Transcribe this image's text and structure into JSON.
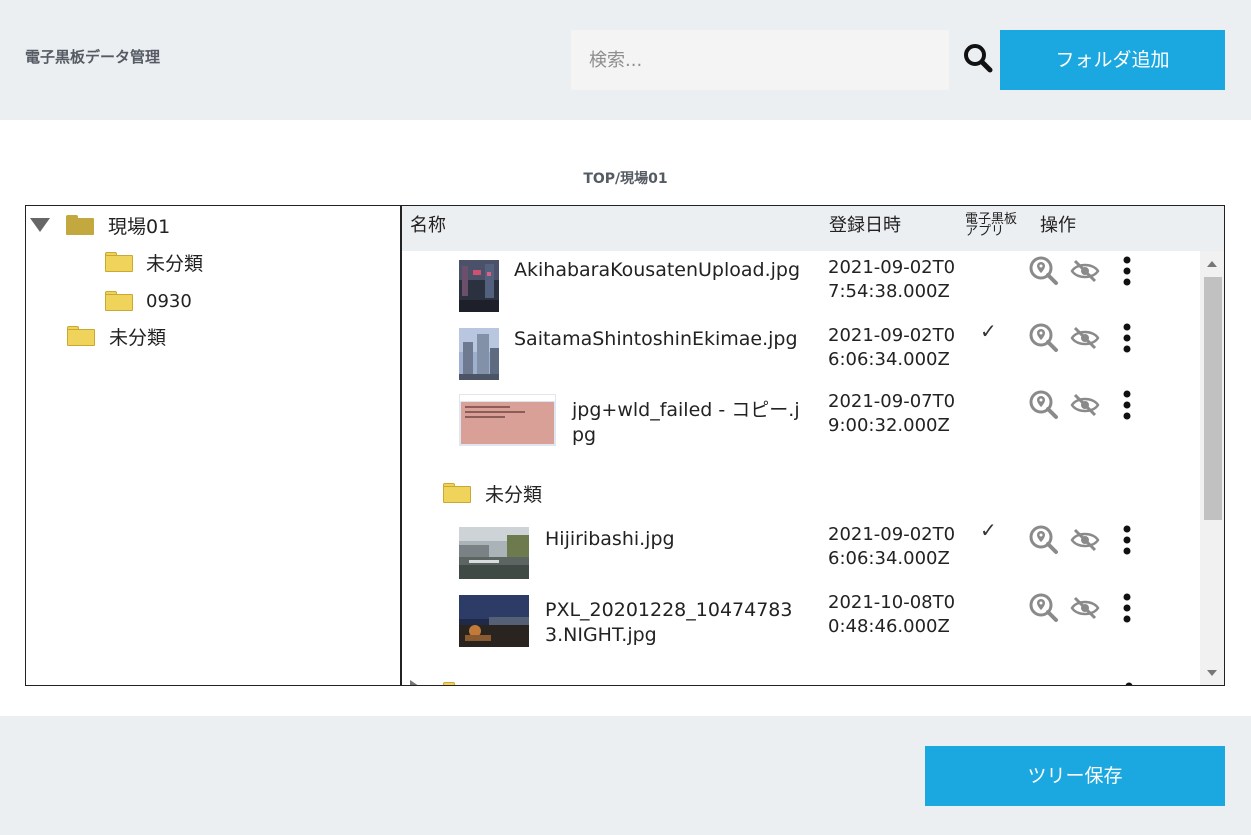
{
  "header": {
    "app_title": "電子黒板データ管理",
    "search_placeholder": "検索...",
    "add_folder_label": "フォルダ追加"
  },
  "breadcrumb": "TOP/現場01",
  "tree": {
    "items": [
      {
        "label": "現場01",
        "expanded": true
      },
      {
        "label": "未分類"
      },
      {
        "label": "0930"
      },
      {
        "label": "未分類"
      }
    ]
  },
  "list": {
    "columns": {
      "name": "名称",
      "date": "登録日時",
      "app_line1": "電子黒板",
      "app_line2": "アプリ",
      "ops": "操作"
    },
    "files": [
      {
        "name": "AkihabaraKousatenUpload.jpg",
        "date": "2021-09-02T07:54:38.000Z",
        "app": ""
      },
      {
        "name": "SaitamaShintoshinEkimae.jpg",
        "date": "2021-09-02T06:06:34.000Z",
        "app": "✓"
      },
      {
        "name": "jpg+wld_failed - コピー.jpg",
        "date": "2021-09-07T09:00:32.000Z",
        "app": ""
      }
    ],
    "subfolder": {
      "label": "未分類"
    },
    "subfiles": [
      {
        "name": "Hijiribashi.jpg",
        "date": "2021-09-02T06:06:34.000Z",
        "app": "✓"
      },
      {
        "name": "PXL_20201228_104747833.NIGHT.jpg",
        "date": "2021-10-08T00:48:46.000Z",
        "app": ""
      }
    ]
  },
  "footer": {
    "save_label": "ツリー保存"
  },
  "colors": {
    "accent": "#1ba8e0",
    "panel_bg": "#eceff2",
    "folder_dark": "#c2a83e",
    "folder_light": "#efd35b"
  }
}
